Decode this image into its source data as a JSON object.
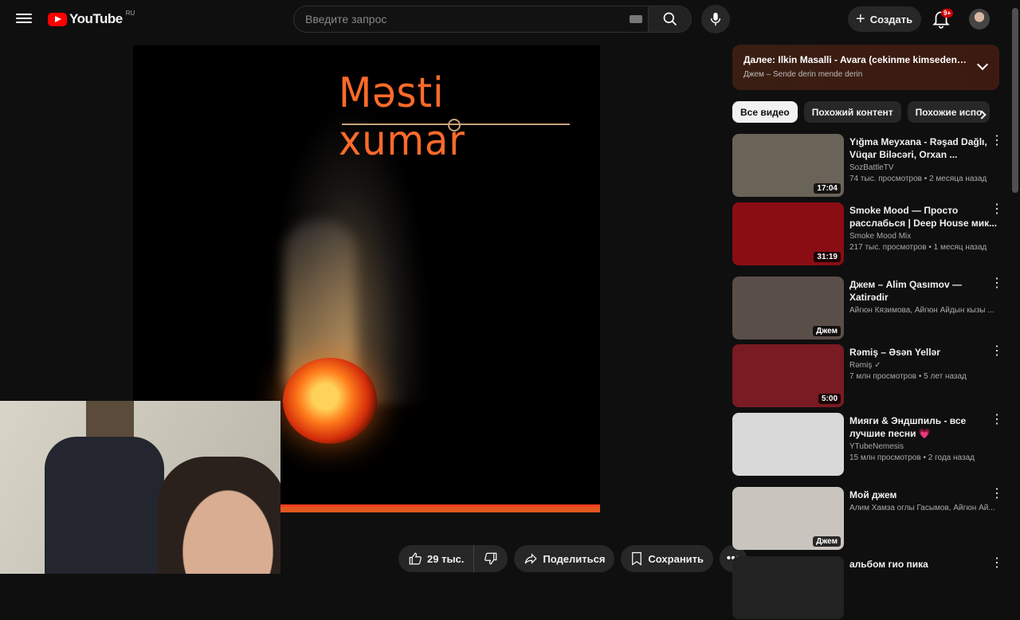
{
  "header": {
    "logo_text": "YouTube",
    "country_code": "RU",
    "search_placeholder": "Введите запрос",
    "create_label": "Создать",
    "notif_badge": "9+"
  },
  "player": {
    "art_title": "Məsti xumar"
  },
  "actions": {
    "likes": "29 тыс.",
    "share": "Поделиться",
    "save": "Сохранить"
  },
  "next_up": {
    "title": "Далее: Ilkin Masalli - Avara (cekinme kimseden ava...",
    "subtitle": "Джем – Sende derin mende derin"
  },
  "chips": [
    "Все видео",
    "Похожий контент",
    "Похожие испо"
  ],
  "recommendations": [
    {
      "title": "Yığma Meyxana - Rəşad Dağlı, Vüqar Biləcəri, Orxan ...",
      "channel": "SozBattleTV",
      "meta": "74 тыс. просмотров • 2 месяца назад",
      "duration": "17:04",
      "thumb_color": "#6a6358"
    },
    {
      "title": "Smoke Mood — Просто расслабься | Deep House мик...",
      "channel": "Smoke Mood Mix",
      "meta": "217 тыс. просмотров • 1 месяц назад",
      "duration": "31:19",
      "thumb_color": "#8a0d14"
    },
    {
      "title": "Джем – Alim Qasımov — Xatirədir",
      "channel": "Айгюн Кязимова, Айгюн Айдын кызы ...",
      "meta": "",
      "duration": "Джем",
      "thumb_color": "#5a4e48"
    },
    {
      "title": "Rəmiş – Əsən Yellər",
      "channel": "Rəmiş ✓",
      "meta": "7 млн просмотров • 5 лет назад",
      "duration": "5:00",
      "thumb_color": "#7a1a22"
    },
    {
      "title": "Мияги & Эндшпиль - все лучшие песни 💗",
      "channel": "YTubeNemesis",
      "meta": "15 млн просмотров • 2 года назад",
      "duration": "",
      "thumb_color": "#d9d9d9"
    },
    {
      "title": "Мой джем",
      "channel": "Алим Хамза оглы Гасымов, Айгюн Ай...",
      "meta": "",
      "duration": "Джем",
      "thumb_color": "#c9c4be"
    },
    {
      "title": "альбом гио пика",
      "channel": "",
      "meta": "",
      "duration": "",
      "thumb_color": "#222222"
    }
  ]
}
